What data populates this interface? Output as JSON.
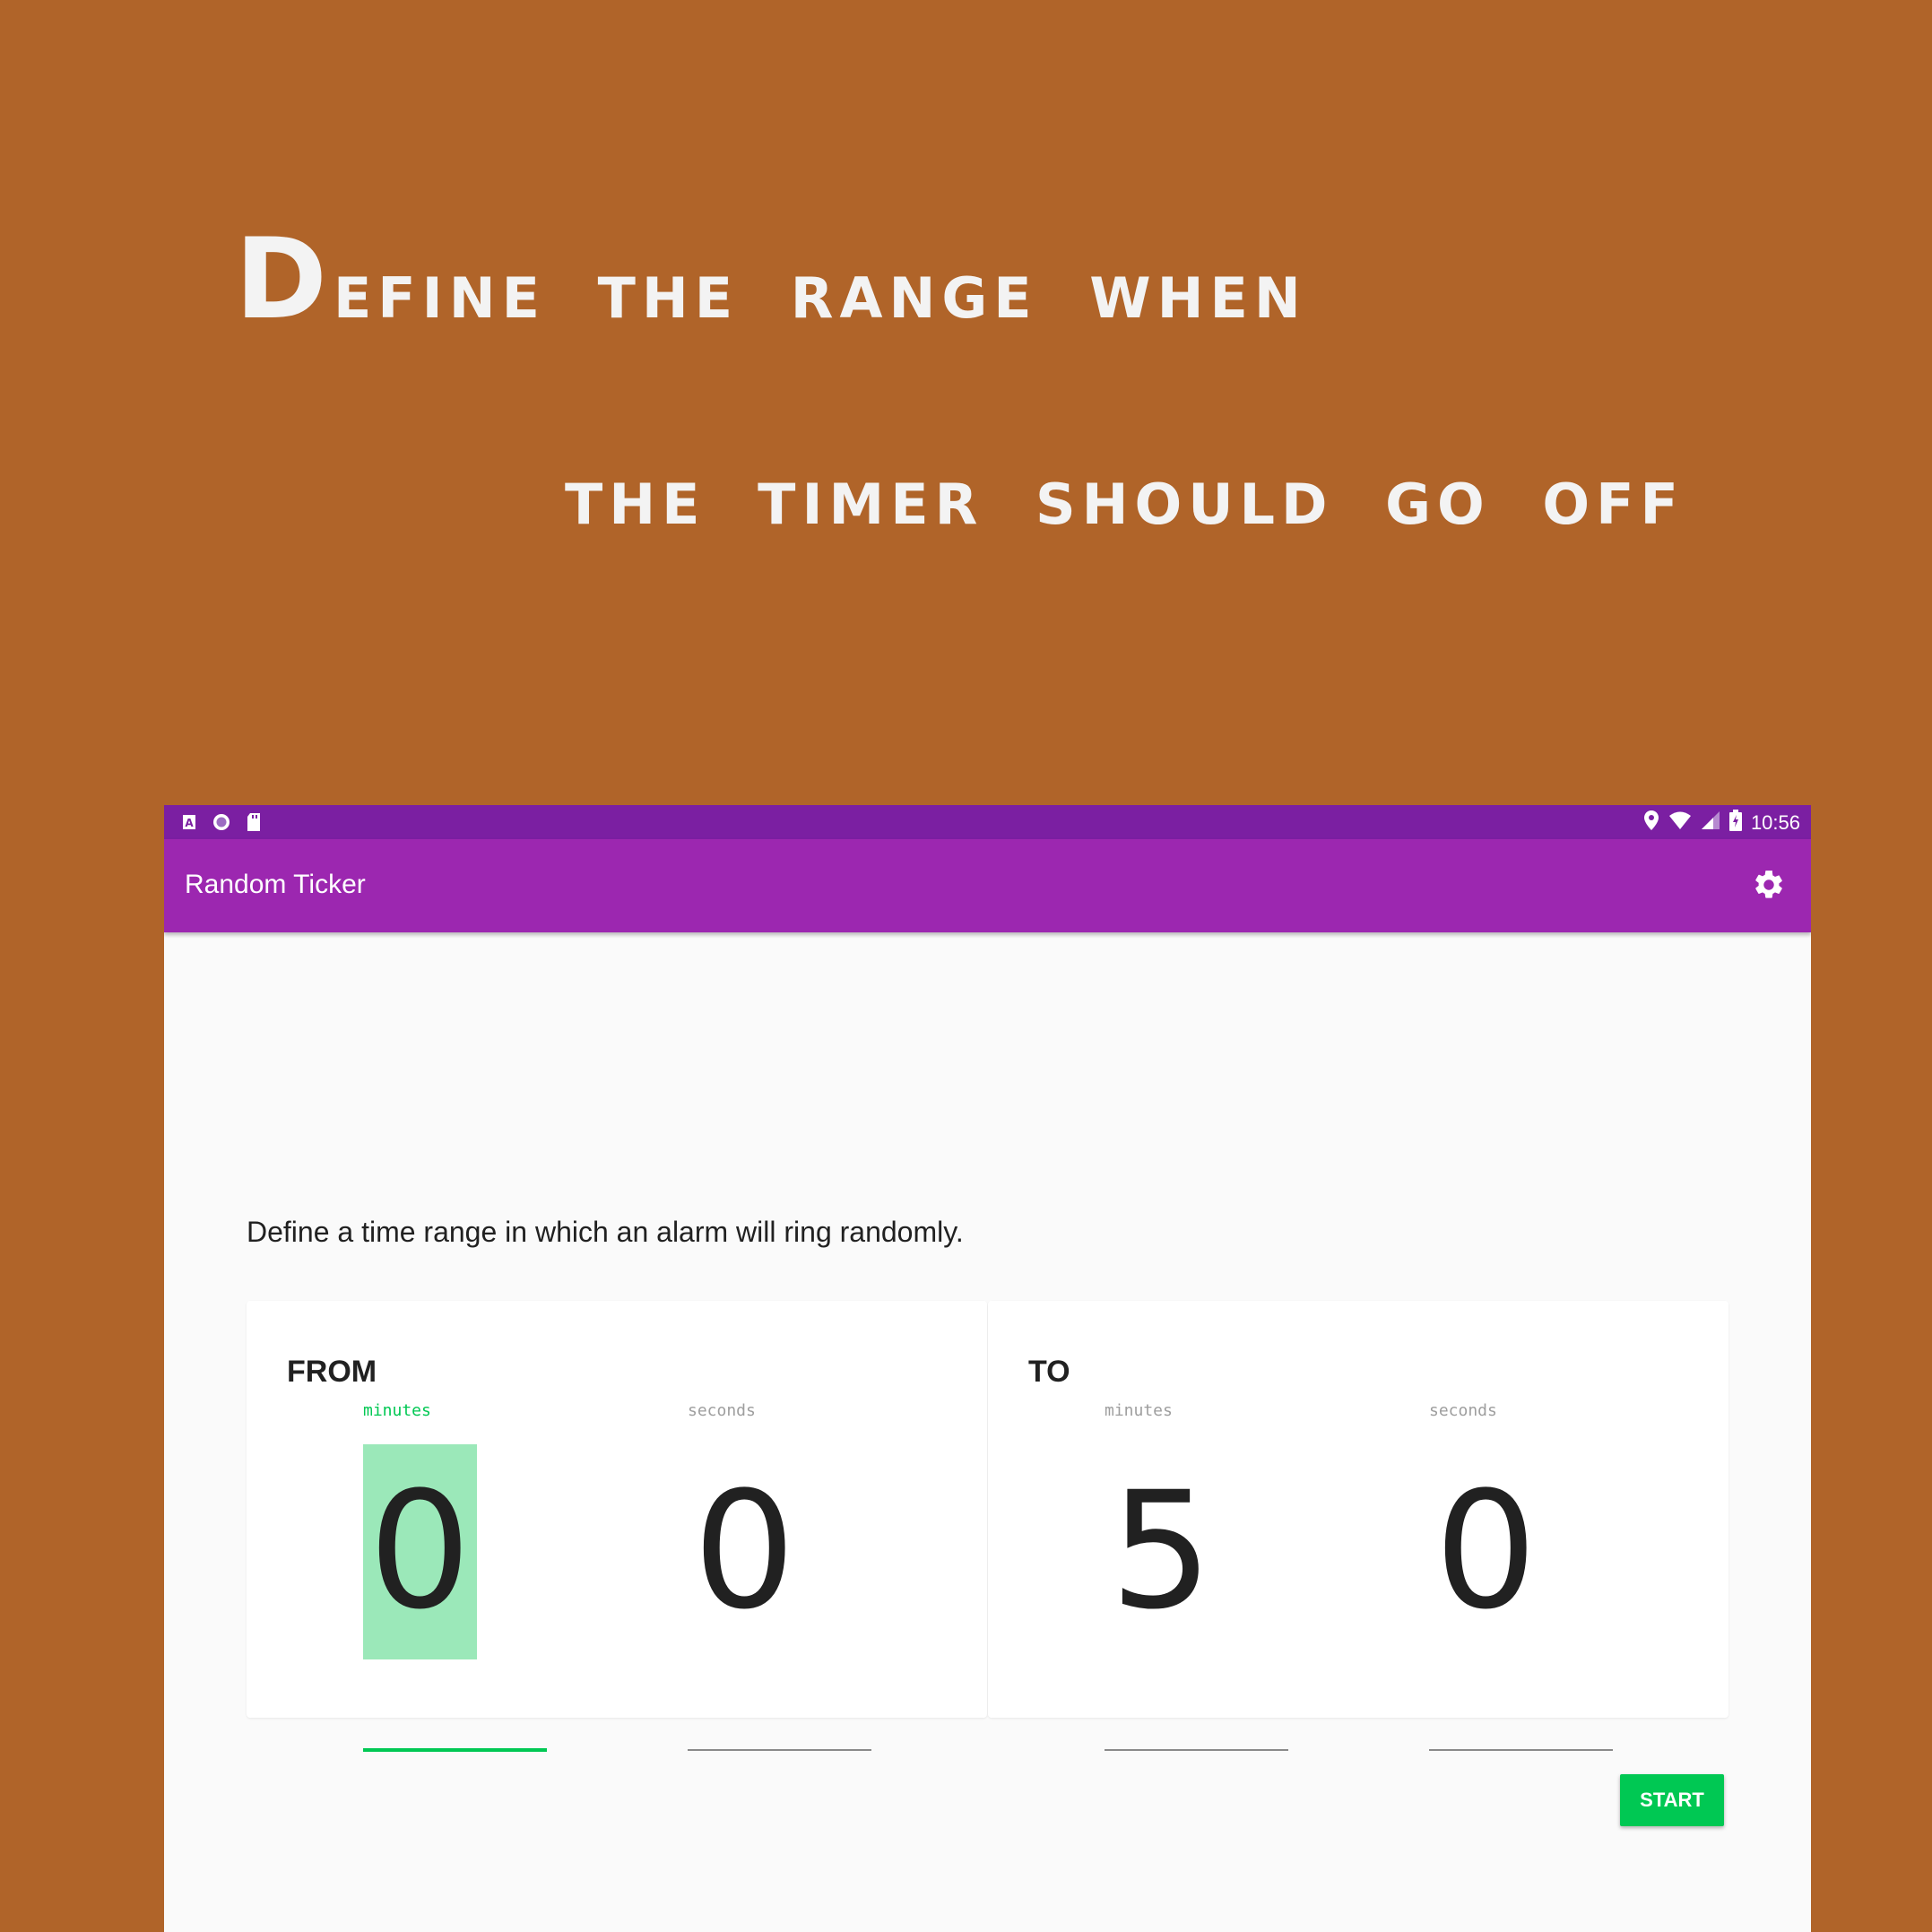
{
  "headline": {
    "line1_cap": "D",
    "line1_rest": "efine the range when",
    "line2": "the timer should go off"
  },
  "statusbar": {
    "left_icons": [
      "a-icon",
      "circle-icon",
      "sd-card-icon"
    ],
    "right_icons": [
      "location-icon",
      "wifi-icon",
      "signal-icon",
      "battery-icon"
    ],
    "time": "10:56"
  },
  "appbar": {
    "title": "Random Ticker",
    "settings_icon": "gear-icon"
  },
  "description": "Define a time range in which an alarm will ring randomly.",
  "from": {
    "title": "FROM",
    "minutes_label": "minutes",
    "minutes_value": "0",
    "seconds_label": "seconds",
    "seconds_value": "0"
  },
  "to": {
    "title": "TO",
    "minutes_label": "minutes",
    "minutes_value": "5",
    "seconds_label": "seconds",
    "seconds_value": "0"
  },
  "start_label": "START",
  "colors": {
    "background": "#b06429",
    "statusbar": "#7b1fa2",
    "appbar": "#9c27b0",
    "accent": "#00c853",
    "selection": "#9be8b9"
  }
}
